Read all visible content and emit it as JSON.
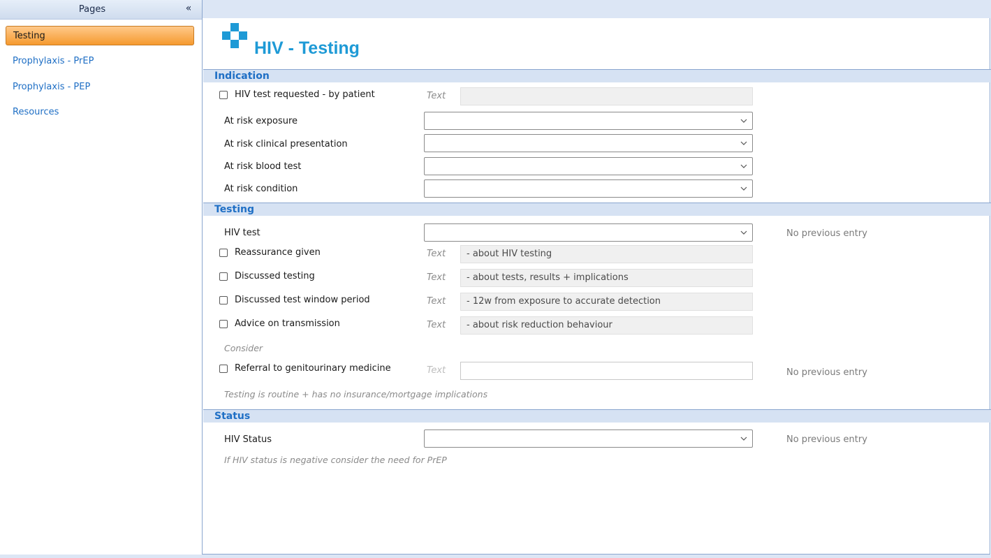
{
  "sidebar": {
    "title": "Pages",
    "collapse_symbol": "«",
    "items": [
      {
        "label": "Testing",
        "active": true
      },
      {
        "label": "Prophylaxis - PrEP"
      },
      {
        "label": "Prophylaxis - PEP"
      },
      {
        "label": "Resources"
      }
    ]
  },
  "page": {
    "title": "HIV - Testing",
    "icon": "medical-cross-icon",
    "accent": "#1e9ad6"
  },
  "indication": {
    "header": "Indication",
    "hiv_requested": {
      "label": "HIV test requested - by patient",
      "text_hint": "Text",
      "value": ""
    },
    "at_risk_exposure": "At risk exposure",
    "at_risk_clinical": "At risk clinical presentation",
    "at_risk_blood": "At risk blood test",
    "at_risk_condition": "At risk condition"
  },
  "testing": {
    "header": "Testing",
    "hiv_test": {
      "label": "HIV test",
      "prev": "No previous entry"
    },
    "reassurance": {
      "label": "Reassurance given",
      "text_hint": "Text",
      "value": "- about HIV testing"
    },
    "discussed_testing": {
      "label": "Discussed testing",
      "text_hint": "Text",
      "value": "- about tests, results + implications"
    },
    "window_period": {
      "label": "Discussed test window period",
      "text_hint": "Text",
      "value": "- 12w from exposure to accurate detection"
    },
    "advice_transmission": {
      "label": "Advice on transmission",
      "text_hint": "Text",
      "value": "- about risk reduction behaviour"
    },
    "consider_label": "Consider",
    "referral": {
      "label": "Referral to genitourinary medicine",
      "text_hint": "Text",
      "value": "",
      "prev": "No previous entry"
    },
    "routine_note": "Testing is routine + has no insurance/mortgage implications"
  },
  "status": {
    "header": "Status",
    "hiv_status": {
      "label": "HIV Status",
      "prev": "No previous entry"
    },
    "note": "If HIV status is negative consider the need for PrEP"
  }
}
